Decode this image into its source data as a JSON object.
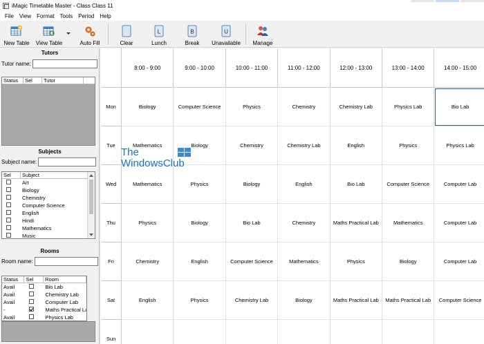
{
  "window": {
    "title": "iMagic Timetable Master - Class Class 11"
  },
  "menu": [
    "File",
    "View",
    "Format",
    "Tools",
    "Period",
    "Help"
  ],
  "toolbar": {
    "new_table": "New Table",
    "view_table": "View Table",
    "auto_fill": "Auto Fill",
    "clear": "Clear",
    "lunch": "Lunch",
    "break": "Break",
    "unavailable": "Unavailable",
    "manage": "Manage",
    "lunch_icon_letter": "L",
    "break_icon_letter": "B",
    "unavailable_icon_letter": "U"
  },
  "tutors": {
    "title": "Tutors",
    "name_label": "Tutor name:",
    "name_value": "",
    "columns": [
      "Status",
      "Sel",
      "Tutor"
    ],
    "rows": []
  },
  "subjects": {
    "title": "Subjects",
    "name_label": "Subject name:",
    "name_value": "",
    "columns": [
      "Sel",
      "Subject"
    ],
    "items": [
      "Art",
      "Biology",
      "Chemistry",
      "Computer Science",
      "English",
      "Hindi",
      "Mathematics",
      "Music"
    ]
  },
  "rooms": {
    "title": "Rooms",
    "name_label": "Room name:",
    "name_value": "",
    "columns": [
      "Status",
      "Sel",
      "Room"
    ],
    "rows": [
      {
        "status": "Avail",
        "checked": false,
        "room": "Bio Lab"
      },
      {
        "status": "Avail",
        "checked": false,
        "room": "Chemistry Lab"
      },
      {
        "status": "Avail",
        "checked": false,
        "room": "Computer Lab"
      },
      {
        "status": "-",
        "checked": true,
        "room": "Maths Practical Lab"
      },
      {
        "status": "Avail",
        "checked": false,
        "room": "Physics Lab"
      }
    ]
  },
  "timetable": {
    "periods": [
      "8:00 - 9:00",
      "9:00 - 10:00",
      "10:00 - 11:00",
      "11:00 - 12:00",
      "12:00 - 13:00",
      "13:00 - 14:00",
      "14:00 - 15:00"
    ],
    "days": [
      "Mon",
      "Tue",
      "Wed",
      "Thu",
      "Fri",
      "Sat",
      "Sun"
    ],
    "cells": [
      [
        "Biology",
        "Computer Science",
        "Physics",
        "Chemistry",
        "Chemistry Lab",
        "Physics Lab",
        "Bio Lab"
      ],
      [
        "Mathematics",
        "Biology",
        "Chemistry",
        "Chemistry Lab",
        "English",
        "Physics",
        "Physics Lab"
      ],
      [
        "Mathematics",
        "Physics",
        "Biology",
        "English",
        "Bio Lab",
        "Computer Science",
        "Computer Lab"
      ],
      [
        "Physics",
        "Biology",
        "Bio Lab",
        "Chemistry",
        "Maths Practical Lab",
        "Mathematics",
        "Computer Lab"
      ],
      [
        "Chemistry",
        "English",
        "Computer Science",
        "Mathematics",
        "Physics",
        "Biology",
        "Computer Lab"
      ],
      [
        "English",
        "Physics",
        "Chemistry Lab",
        "Biology",
        "Maths Practical Lab",
        "Maths Practical Lab",
        "Computer Science"
      ],
      [
        "",
        "",
        "",
        "",
        "",
        "",
        ""
      ]
    ],
    "selected": {
      "day": 0,
      "period": 6
    }
  },
  "watermark": {
    "line1": "The",
    "line2": "WindowsClub"
  },
  "colors": {
    "selection": "#2a5caa",
    "watermark": "#1a6fc0"
  }
}
